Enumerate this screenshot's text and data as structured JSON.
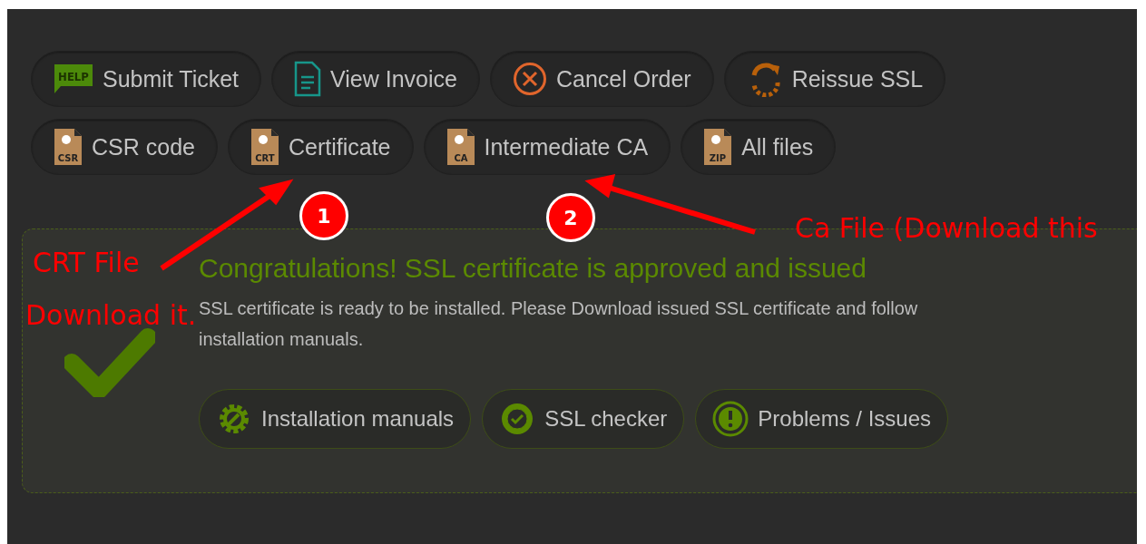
{
  "toolbar_rows": [
    [
      {
        "label": "Submit Ticket",
        "kind": "help"
      },
      {
        "label": "View Invoice",
        "kind": "document"
      },
      {
        "label": "Cancel Order",
        "kind": "cancel"
      },
      {
        "label": "Reissue SSL",
        "kind": "reissue"
      }
    ],
    [
      {
        "label": "CSR code",
        "kind": "file",
        "tag": "CSR"
      },
      {
        "label": "Certificate",
        "kind": "file",
        "tag": "CRT"
      },
      {
        "label": "Intermediate CA",
        "kind": "file",
        "tag": "CA"
      },
      {
        "label": "All files",
        "kind": "file",
        "tag": "ZIP"
      }
    ]
  ],
  "help_icon_text": "HELP",
  "status_panel": {
    "title": "Congratulations! SSL certificate is approved and issued",
    "message": "SSL certificate is ready to be installed. Please Download issued SSL certificate and follow installation manuals.",
    "buttons": [
      {
        "label": "Installation manuals",
        "kind": "gear"
      },
      {
        "label": "SSL checker",
        "kind": "badge"
      },
      {
        "label": "Problems / Issues",
        "kind": "alert"
      }
    ]
  },
  "annotations": [
    {
      "kind": "marker",
      "text": "1"
    },
    {
      "kind": "marker",
      "text": "2"
    },
    {
      "kind": "note",
      "text": "CRT File"
    },
    {
      "kind": "note",
      "text": "Download it."
    },
    {
      "kind": "note",
      "text": "Ca File (Download this"
    }
  ]
}
